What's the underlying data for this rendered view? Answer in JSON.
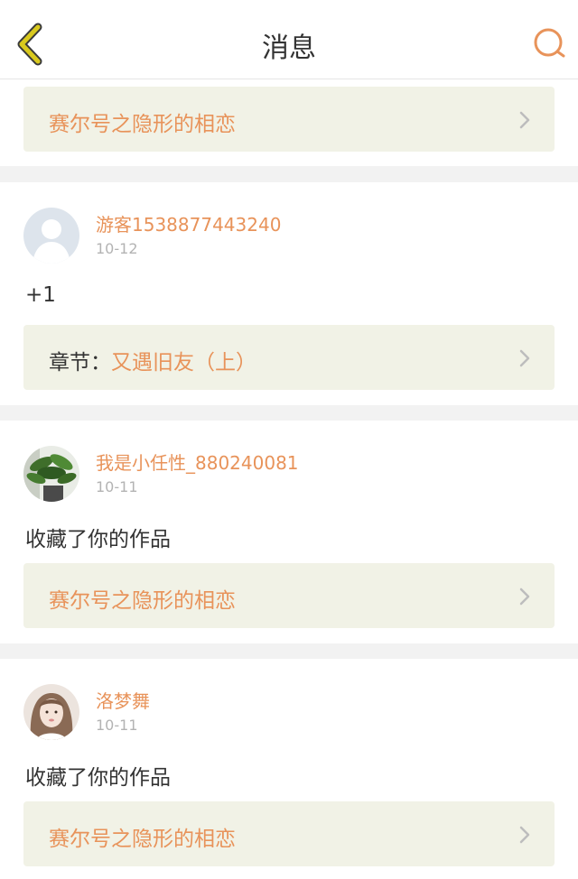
{
  "header": {
    "title": "消息",
    "back_icon": "chevron-left-icon",
    "search_icon": "search-icon",
    "accent_color": "#e8935a",
    "back_color": "#d9c91e"
  },
  "top_link": {
    "label": "赛尔号之隐形的相恋"
  },
  "messages": [
    {
      "username": "游客1538877443240",
      "date": "10-12",
      "text": "+1",
      "link_prefix": "章节：",
      "link_label": "又遇旧友（上）",
      "avatar": "default-avatar"
    },
    {
      "username": "我是小任性_880240081",
      "date": "10-11",
      "text": "收藏了你的作品",
      "link_prefix": "",
      "link_label": "赛尔号之隐形的相恋",
      "avatar": "plant-avatar"
    },
    {
      "username": "洛梦舞",
      "date": "10-11",
      "text": "收藏了你的作品",
      "link_prefix": "",
      "link_label": "赛尔号之隐形的相恋",
      "avatar": "girl-avatar"
    }
  ]
}
